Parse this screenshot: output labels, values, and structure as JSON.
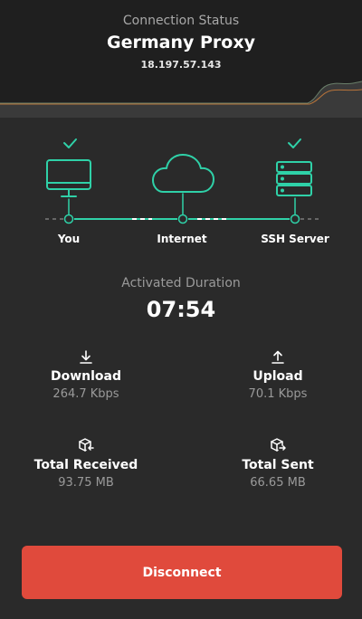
{
  "header": {
    "label": "Connection Status",
    "name": "Germany Proxy",
    "ip": "18.197.57.143"
  },
  "diagram": {
    "nodes": [
      "You",
      "Internet",
      "SSH Server"
    ],
    "accent": "#2fd1a8"
  },
  "duration": {
    "label": "Activated Duration",
    "value": "07:54"
  },
  "stats": {
    "download": {
      "title": "Download",
      "value": "264.7 Kbps",
      "icon": "download-icon"
    },
    "upload": {
      "title": "Upload",
      "value": "70.1 Kbps",
      "icon": "upload-icon"
    },
    "received": {
      "title": "Total Received",
      "value": "93.75 MB",
      "icon": "box-in-icon"
    },
    "sent": {
      "title": "Total Sent",
      "value": "66.65 MB",
      "icon": "box-out-icon"
    }
  },
  "action": {
    "label": "Disconnect",
    "color": "#e04a3c"
  }
}
